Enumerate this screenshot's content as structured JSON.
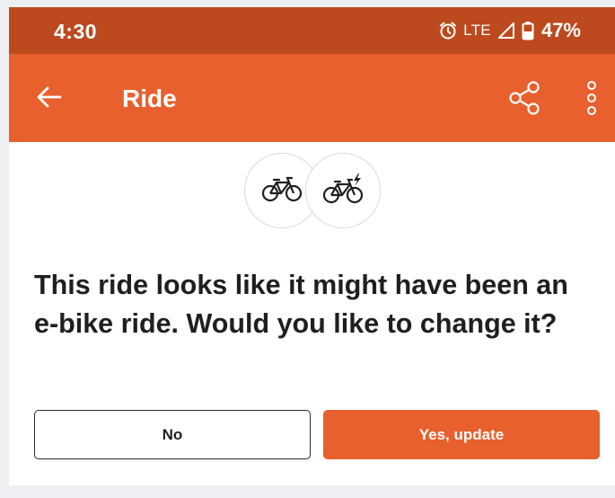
{
  "status_bar": {
    "time": "4:30",
    "network": "LTE",
    "battery": "47%",
    "icons": [
      "alarm-icon",
      "signal-icon",
      "battery-icon"
    ]
  },
  "app_bar": {
    "title": "Ride",
    "icons": [
      "arrow-left-icon",
      "share-icon",
      "more-vertical-icon"
    ]
  },
  "prompt": {
    "icons": [
      "bike-icon",
      "e-bike-icon"
    ],
    "question": "This ride looks like it might have been an e-bike ride. Would you like to change it?",
    "no_label": "No",
    "yes_label": "Yes, update"
  },
  "colors": {
    "status_bar": "#bd4a1e",
    "brand_orange": "#e8602d",
    "text_dark": "#1f1f23",
    "background": "#eeeff2"
  }
}
